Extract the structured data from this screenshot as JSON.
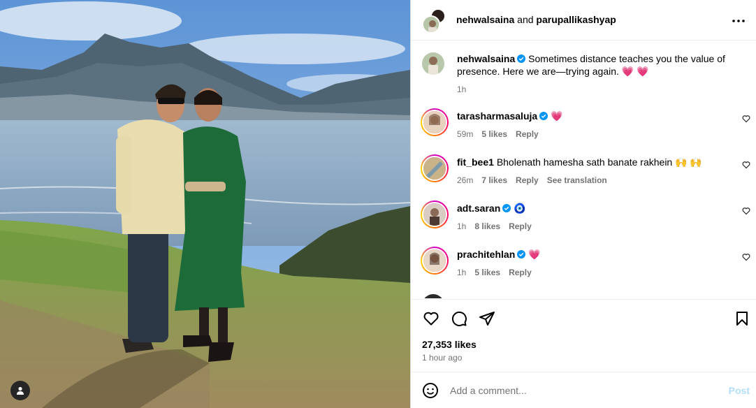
{
  "header": {
    "user1": "nehwalsaina",
    "joiner": "and",
    "user2": "parupallikashyap"
  },
  "caption": {
    "username": "nehwalsaina",
    "text": "Sometimes distance teaches you the value of presence. Here we are—trying again. 💗 💗",
    "time": "1h"
  },
  "comments": [
    {
      "username": "tarasharmasaluja",
      "text": "💗",
      "time": "59m",
      "likes": "5 likes",
      "reply": "Reply",
      "extra": ""
    },
    {
      "username": "fit_bee1",
      "text": "Bholenath hamesha sath banate rakhein 🙌 🙌",
      "time": "26m",
      "likes": "7 likes",
      "reply": "Reply",
      "extra": "See translation"
    },
    {
      "username": "adt.saran",
      "text": "🧿",
      "time": "1h",
      "likes": "8 likes",
      "reply": "Reply",
      "extra": ""
    },
    {
      "username": "prachitehlan",
      "text": "💗",
      "time": "1h",
      "likes": "5 likes",
      "reply": "Reply",
      "extra": ""
    }
  ],
  "stats": {
    "likes": "27,353 likes",
    "posted": "1 hour ago"
  },
  "add_comment": {
    "placeholder": "Add a comment...",
    "post_label": "Post"
  },
  "colors": {
    "verified": "#0095f6",
    "post_disabled": "#b2dffc",
    "heart_red": "#ff3040"
  },
  "icons": [
    "more-icon",
    "verified-icon",
    "heart-icon",
    "comment-icon",
    "share-icon",
    "bookmark-icon",
    "emoji-icon",
    "user-tag-icon"
  ]
}
